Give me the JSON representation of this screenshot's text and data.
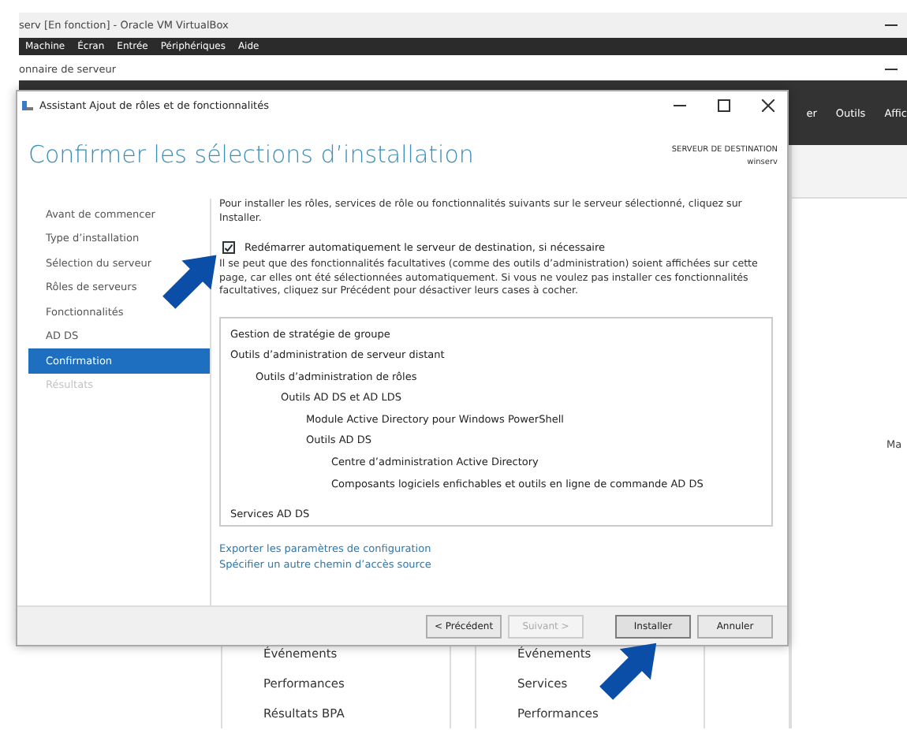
{
  "virtualbox": {
    "title": "serv [En fonction] - Oracle VM VirtualBox",
    "menu": [
      "Machine",
      "Écran",
      "Entrée",
      "Périphériques",
      "Aide"
    ]
  },
  "server_manager": {
    "title": "onnaire de serveur",
    "header_menu": [
      "er",
      "Outils",
      "Affic"
    ],
    "side_text": "Ma",
    "tiles": [
      {
        "items": [
          "Événements",
          "Performances",
          "Résultats BPA"
        ]
      },
      {
        "items": [
          "Événements",
          "Services",
          "Performances"
        ]
      }
    ]
  },
  "wizard": {
    "title": "Assistant Ajout de rôles et de fonctionnalités",
    "heading": "Confirmer les sélections d’installation",
    "destination_label": "SERVEUR DE DESTINATION",
    "destination_server": "winserv",
    "steps": [
      {
        "label": "Avant de commencer",
        "selected": false,
        "disabled": false
      },
      {
        "label": "Type d’installation",
        "selected": false,
        "disabled": false
      },
      {
        "label": "Sélection du serveur",
        "selected": false,
        "disabled": false
      },
      {
        "label": "Rôles de serveurs",
        "selected": false,
        "disabled": false
      },
      {
        "label": "Fonctionnalités",
        "selected": false,
        "disabled": false
      },
      {
        "label": "AD DS",
        "selected": false,
        "disabled": false
      },
      {
        "label": "Confirmation",
        "selected": true,
        "disabled": false
      },
      {
        "label": "Résultats",
        "selected": false,
        "disabled": true
      }
    ],
    "intro": "Pour installer les rôles, services de rôle ou fonctionnalités suivants sur le serveur sélectionné, cliquez sur Installer.",
    "restart": {
      "label": "Redémarrer automatiquement le serveur de destination, si nécessaire",
      "checked": true
    },
    "notice": "Il se peut que des fonctionnalités facultatives (comme des outils d’administration) soient affichées sur cette page, car elles ont été sélectionnées automatiquement. Si vous ne voulez pas installer ces fonctionnalités facultatives, cliquez sur Précédent pour désactiver leurs cases à cocher.",
    "features": [
      {
        "label": "Gestion de stratégie de groupe"
      },
      {
        "label": "Outils d’administration de serveur distant",
        "children": [
          {
            "label": "Outils d’administration de rôles",
            "children": [
              {
                "label": "Outils AD DS et AD LDS",
                "children": [
                  {
                    "label": "Module Active Directory pour Windows PowerShell"
                  },
                  {
                    "label": "Outils AD DS",
                    "children": [
                      {
                        "label": "Centre d’administration Active Directory"
                      },
                      {
                        "label": "Composants logiciels enfichables et outils en ligne de commande AD DS"
                      }
                    ]
                  }
                ]
              }
            ]
          }
        ]
      },
      {
        "label": "Services AD DS"
      }
    ],
    "links": [
      "Exporter les paramètres de configuration",
      "Spécifier un autre chemin d’accès source"
    ],
    "buttons": [
      {
        "label": "< Précédent",
        "disabled": false,
        "focused": false
      },
      {
        "label": "Suivant >",
        "disabled": true,
        "focused": false
      },
      {
        "label": "Installer",
        "disabled": false,
        "focused": true
      },
      {
        "label": "Annuler",
        "disabled": false,
        "focused": false
      }
    ]
  }
}
